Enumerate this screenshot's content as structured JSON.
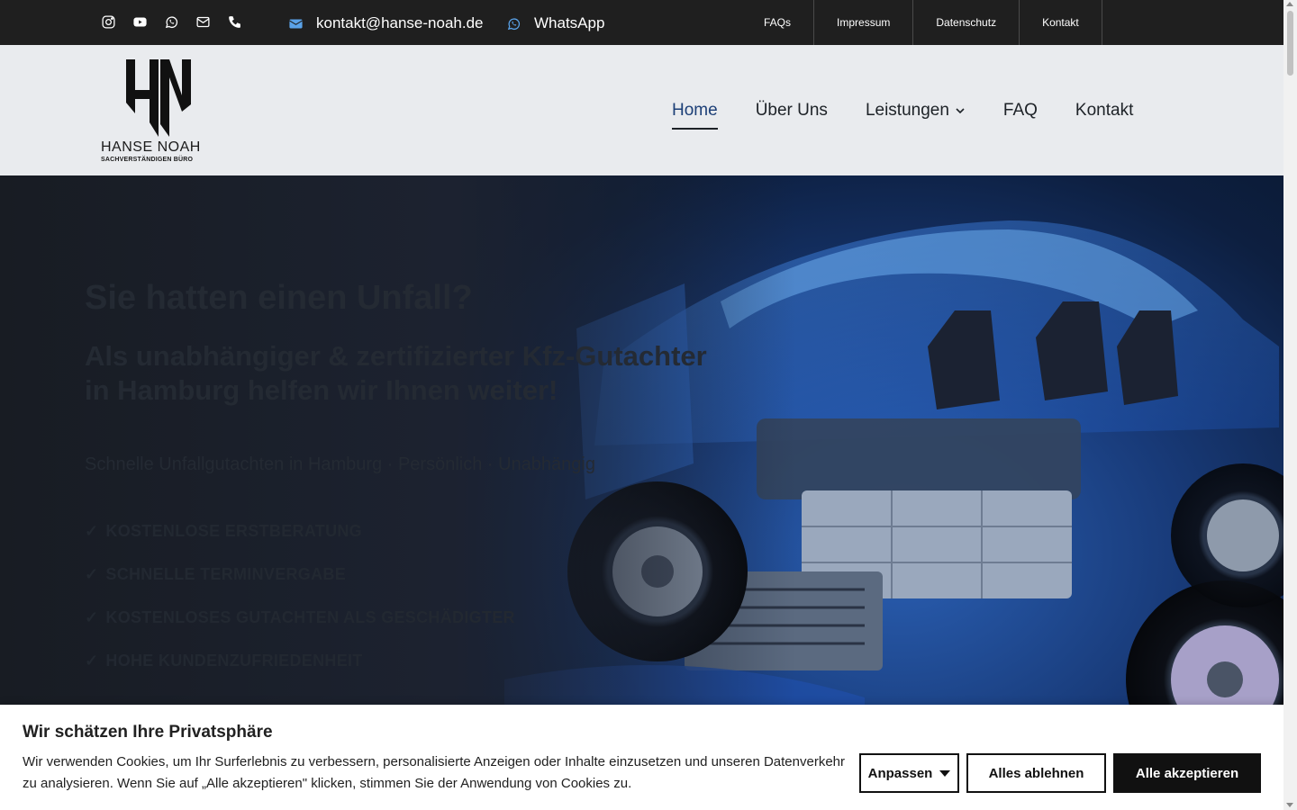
{
  "topbar": {
    "social_icons": [
      "instagram-icon",
      "youtube-icon",
      "whatsapp-icon",
      "mail-icon",
      "phone-icon"
    ],
    "email": "kontakt@hanse-noah.de",
    "whatsapp": "WhatsApp",
    "links": [
      "FAQs",
      "Impressum",
      "Datenschutz",
      "Kontakt"
    ]
  },
  "logo": {
    "name": "HANSE NOAH",
    "sub": "SACHVERSTÄNDIGEN BÜRO"
  },
  "nav": {
    "items": [
      "Home",
      "Über Uns",
      "Leistungen",
      "FAQ",
      "Kontakt"
    ],
    "active": "Home"
  },
  "hero": {
    "title": "Sie hatten einen Unfall?",
    "subtitle": "Als unabhängiger & zertifizierter Kfz-Gutachter in Hamburg helfen wir Ihnen weiter!",
    "lead": "Schnelle Unfallgutachten in Hamburg · Persönlich · Unabhängig",
    "checks": [
      "KOSTENLOSE ERSTBERATUNG",
      "SCHNELLE TERMINVERGABE",
      "KOSTENLOSES GUTACHTEN ALS GESCHÄDIGTER",
      "HOHE KUNDENZUFRIEDENHEIT"
    ]
  },
  "cookie": {
    "title": "Wir schätzen Ihre Privatsphäre",
    "text": "Wir verwenden Cookies, um Ihr Surferlebnis zu verbessern, personalisierte Anzeigen oder Inhalte einzusetzen und unseren Datenverkehr zu analysieren. Wenn Sie auf „Alle akzeptieren\" klicken, stimmen Sie der Anwendung von Cookies zu.",
    "customize": "Anpassen",
    "reject": "Alles ablehnen",
    "accept": "Alle akzeptieren"
  },
  "colors": {
    "topbar": "#1f1f1f",
    "header": "#e9ebee",
    "accent_email_icon": "#5aa2e8",
    "nav_active": "#1c3f77"
  }
}
